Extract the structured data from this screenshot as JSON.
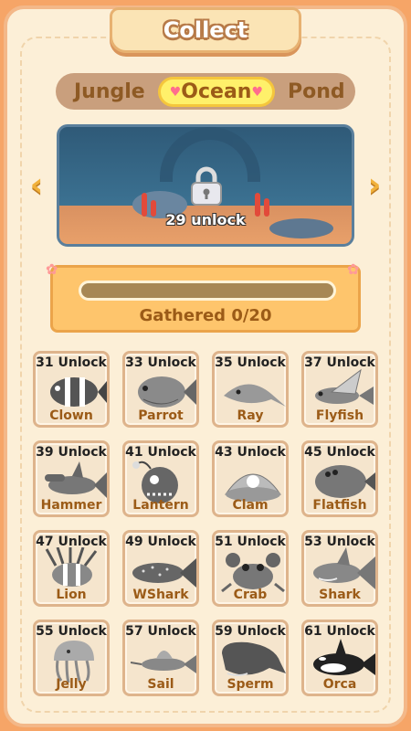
{
  "title": "Collect",
  "tabs": [
    {
      "label": "Jungle",
      "active": false
    },
    {
      "label": "Ocean",
      "active": true
    },
    {
      "label": "Pond",
      "active": false
    }
  ],
  "scene": {
    "lock_text": "29 unlock"
  },
  "progress": {
    "label": "Gathered 0/20",
    "value": 0,
    "max": 20
  },
  "creatures": [
    {
      "unlock": "31 Unlock",
      "name": "Clown",
      "icon": "clownfish-icon"
    },
    {
      "unlock": "33 Unlock",
      "name": "Parrot",
      "icon": "parrotfish-icon"
    },
    {
      "unlock": "35 Unlock",
      "name": "Ray",
      "icon": "ray-icon"
    },
    {
      "unlock": "37 Unlock",
      "name": "Flyfish",
      "icon": "flyingfish-icon"
    },
    {
      "unlock": "39 Unlock",
      "name": "Hammer",
      "icon": "hammerhead-icon"
    },
    {
      "unlock": "41 Unlock",
      "name": "Lantern",
      "icon": "lanternfish-icon"
    },
    {
      "unlock": "43 Unlock",
      "name": "Clam",
      "icon": "clam-icon"
    },
    {
      "unlock": "45 Unlock",
      "name": "Flatfish",
      "icon": "flatfish-icon"
    },
    {
      "unlock": "47 Unlock",
      "name": "Lion",
      "icon": "lionfish-icon"
    },
    {
      "unlock": "49 Unlock",
      "name": "WShark",
      "icon": "whaleshark-icon"
    },
    {
      "unlock": "51 Unlock",
      "name": "Crab",
      "icon": "crab-icon"
    },
    {
      "unlock": "53 Unlock",
      "name": "Shark",
      "icon": "shark-icon"
    },
    {
      "unlock": "55 Unlock",
      "name": "Jelly",
      "icon": "jellyfish-icon"
    },
    {
      "unlock": "57 Unlock",
      "name": "Sail",
      "icon": "sailfish-icon"
    },
    {
      "unlock": "59 Unlock",
      "name": "Sperm",
      "icon": "spermwhale-icon"
    },
    {
      "unlock": "61 Unlock",
      "name": "Orca",
      "icon": "orca-icon"
    }
  ]
}
